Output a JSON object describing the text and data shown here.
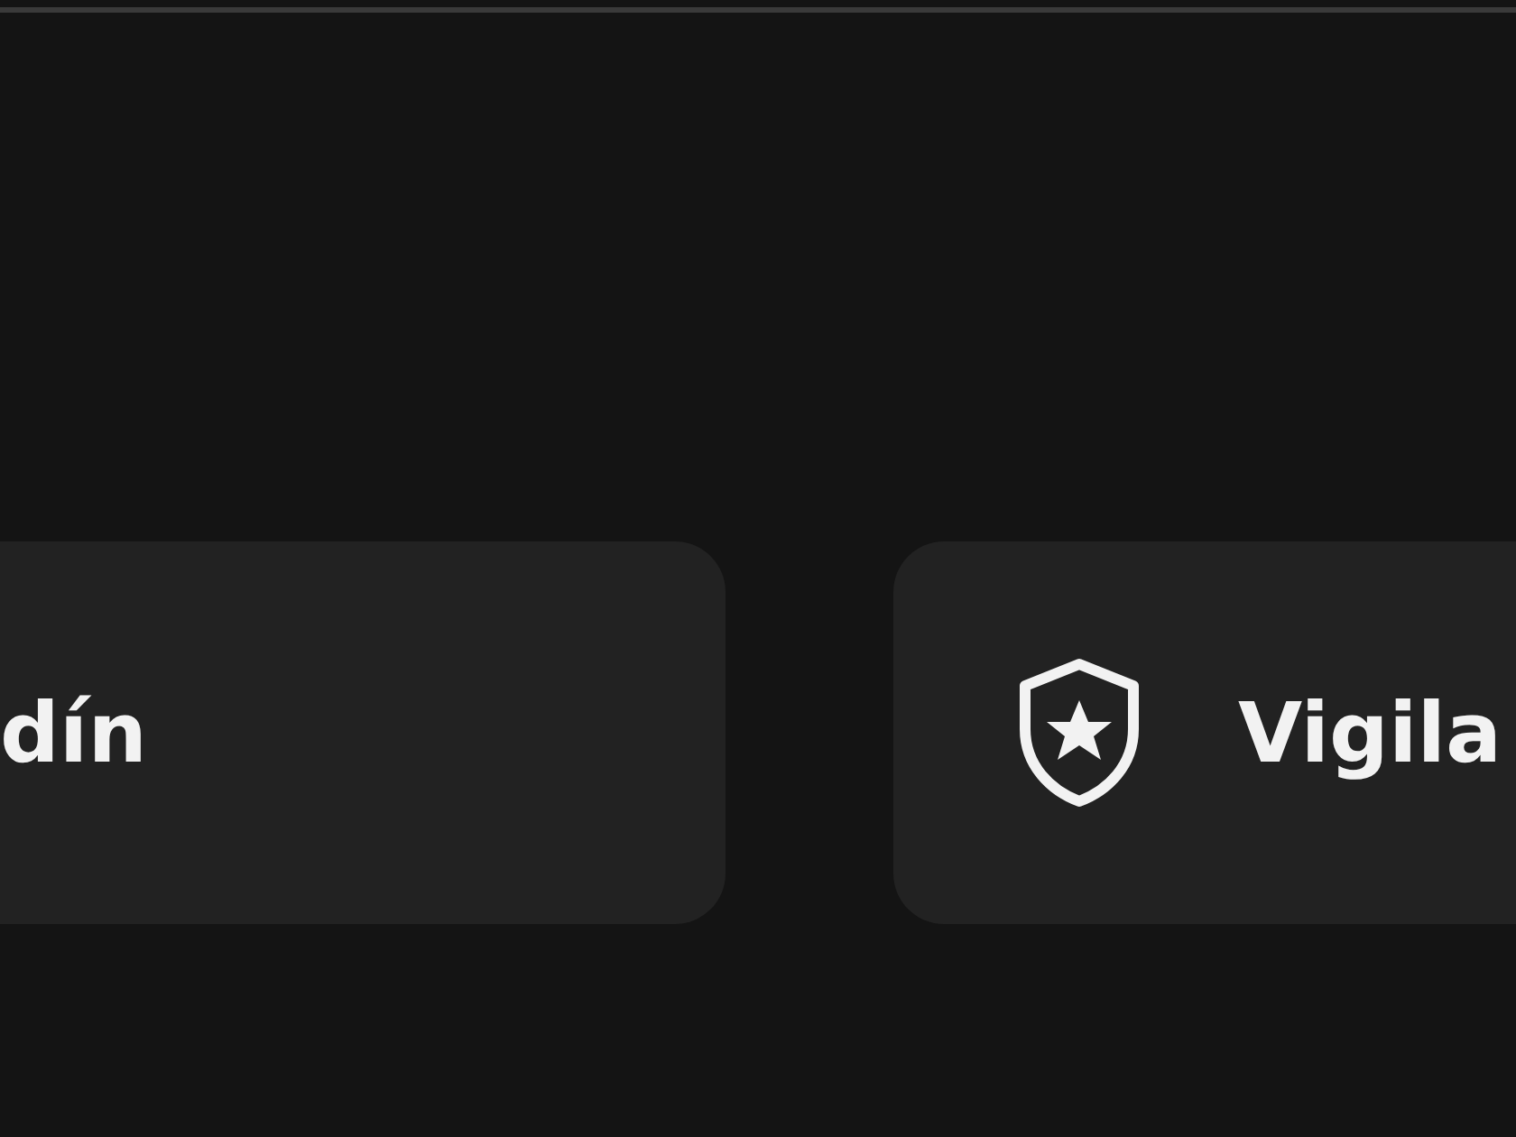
{
  "tiles": [
    {
      "kind": "plain",
      "label": "dín"
    },
    {
      "kind": "shield",
      "label": "Vigila"
    }
  ]
}
